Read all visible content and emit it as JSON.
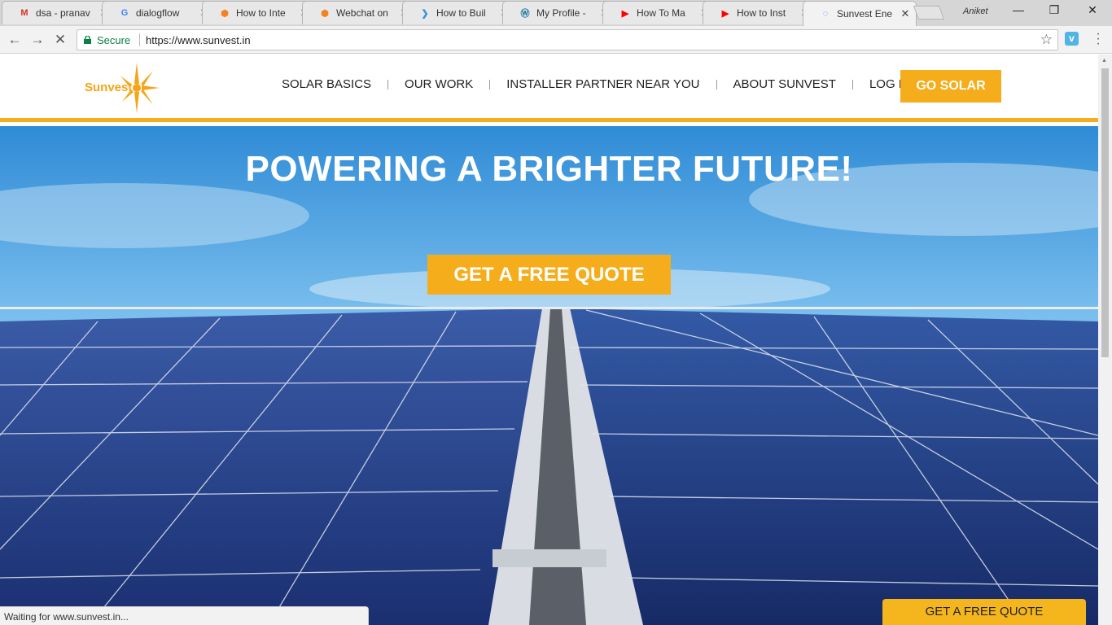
{
  "browser": {
    "tabs": [
      {
        "title": "dsa - pranav",
        "icon": "gmail-icon",
        "color": "#d93025"
      },
      {
        "title": "dialogflow",
        "icon": "google-icon",
        "color": "#4285f4"
      },
      {
        "title": "How to Inte",
        "icon": "orange-hexagon-icon",
        "color": "#f58220"
      },
      {
        "title": "Webchat on",
        "icon": "orange-hexagon-icon",
        "color": "#f58220"
      },
      {
        "title": "How to Buil",
        "icon": "chevron-logo-icon",
        "color": "#3b8fd9"
      },
      {
        "title": "My Profile -",
        "icon": "wordpress-icon",
        "color": "#21759b"
      },
      {
        "title": "How To Ma",
        "icon": "youtube-icon",
        "color": "#ff0000"
      },
      {
        "title": "How to Inst",
        "icon": "youtube-icon",
        "color": "#ff0000"
      },
      {
        "title": "Sunvest Ene",
        "icon": "loading-icon",
        "color": "#4285f4",
        "active": true
      }
    ],
    "profile_name": "Aniket",
    "secure_label": "Secure",
    "url": "https://www.sunvest.in",
    "status_text": "Waiting for www.sunvest.in...",
    "window_controls": {
      "minimize": "—",
      "restore": "❐",
      "close": "✕"
    }
  },
  "site": {
    "logo_text": "Sunvest",
    "nav": [
      {
        "label": "SOLAR BASICS"
      },
      {
        "label": "OUR WORK"
      },
      {
        "label": "INSTALLER PARTNER NEAR YOU"
      },
      {
        "label": "ABOUT SUNVEST"
      },
      {
        "label": "LOG IN"
      }
    ],
    "cta_label": "GO SOLAR",
    "hero": {
      "title": "POWERING A BRIGHTER FUTURE!",
      "button_label": "GET A FREE QUOTE"
    },
    "floating_button_label": "GET A FREE QUOTE",
    "colors": {
      "accent": "#f5ad1c",
      "sky": "#4aa3e0",
      "panel": "#1f3d84"
    }
  }
}
